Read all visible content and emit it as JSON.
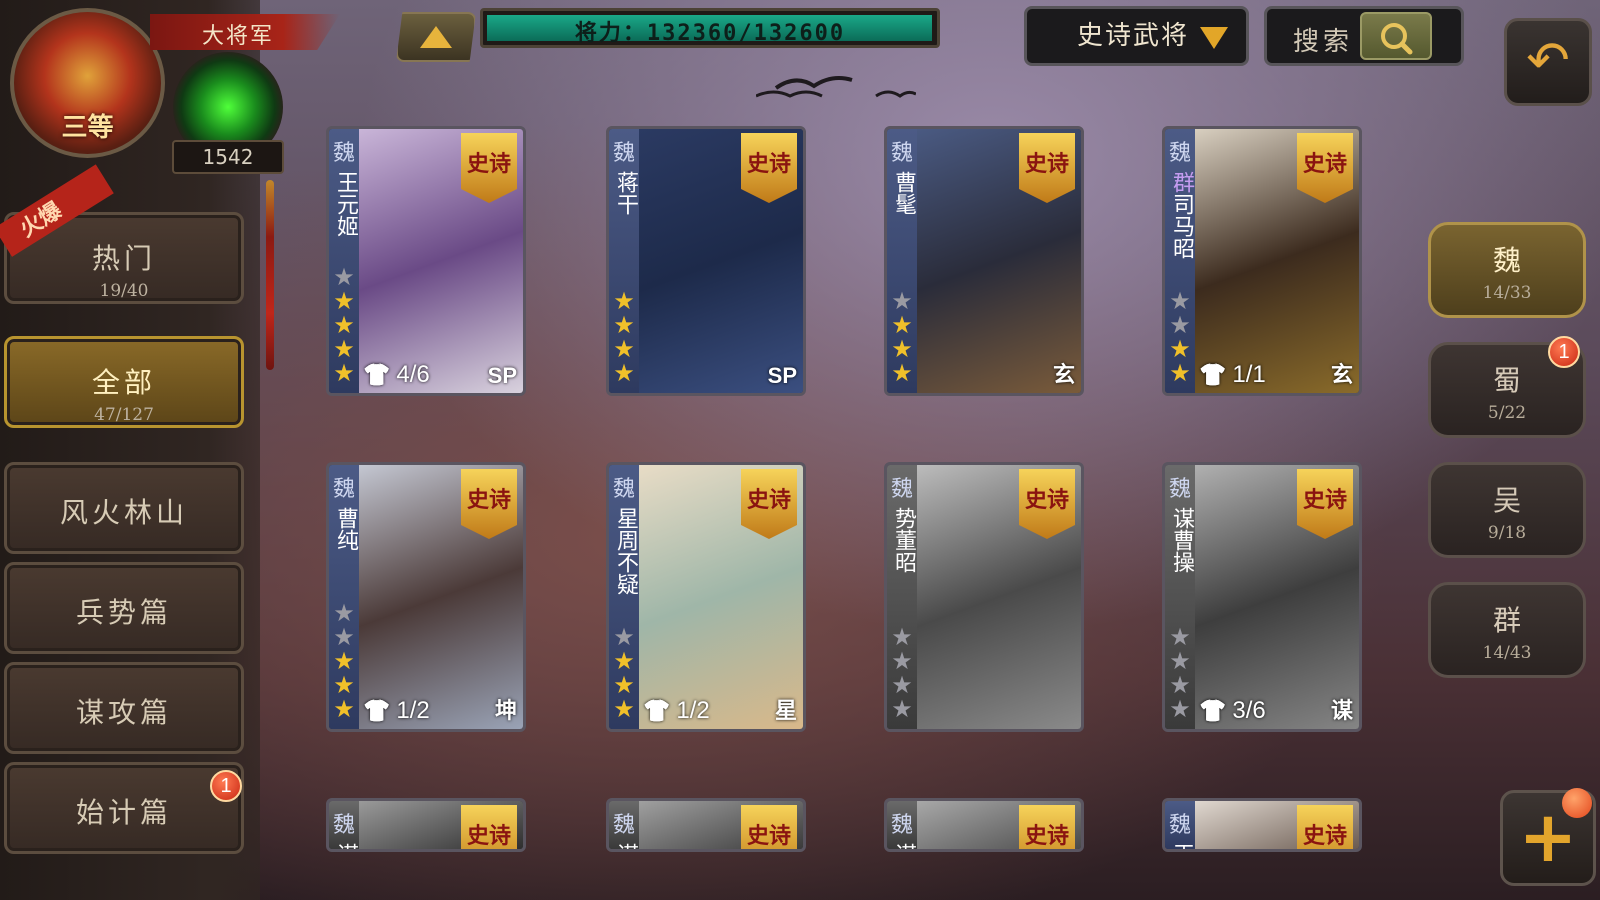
{
  "header": {
    "rank_text": "三等",
    "title": "大将军",
    "gem_count": "1542",
    "power_text": "将力：132360/132600",
    "power_current": 132360,
    "power_max": 132600,
    "filter_label": "史诗武将",
    "search_label": "搜索"
  },
  "categories": [
    {
      "label": "热门",
      "count": "19/40",
      "ribbon": "火爆"
    },
    {
      "label": "全部",
      "count": "47/127",
      "active": true
    },
    {
      "label": "风火林山"
    },
    {
      "label": "兵势篇"
    },
    {
      "label": "谋攻篇"
    },
    {
      "label": "始计篇",
      "badge": "1"
    }
  ],
  "factions": [
    {
      "label": "魏",
      "count": "14/33",
      "active": true
    },
    {
      "label": "蜀",
      "count": "5/22",
      "badge": "1"
    },
    {
      "label": "吴",
      "count": "9/18"
    },
    {
      "label": "群",
      "count": "14/43"
    }
  ],
  "cards": [
    {
      "faction": "魏",
      "name": "王元姬",
      "stars_filled": 4,
      "stars_empty": 1,
      "epic": "史诗",
      "skin": "4/6",
      "tag": "SP"
    },
    {
      "faction": "魏",
      "name": "蒋干",
      "stars_filled": 4,
      "stars_empty": 0,
      "epic": "史诗",
      "skin": "",
      "tag": "SP"
    },
    {
      "faction": "魏",
      "name": "曹髦",
      "stars_filled": 3,
      "stars_empty": 1,
      "epic": "史诗",
      "skin": "",
      "tag": "玄"
    },
    {
      "faction": "魏",
      "faction2": "群",
      "name": "司马昭",
      "stars_filled": 2,
      "stars_empty": 2,
      "epic": "史诗",
      "skin": "1/1",
      "tag": "玄"
    },
    {
      "faction": "魏",
      "name": "曹纯",
      "stars_filled": 3,
      "stars_empty": 2,
      "epic": "史诗",
      "skin": "1/2",
      "tag": "坤"
    },
    {
      "faction": "魏",
      "name": "星周不疑",
      "stars_filled": 3,
      "stars_empty": 1,
      "epic": "史诗",
      "skin": "1/2",
      "tag": "星"
    },
    {
      "faction": "魏",
      "name": "势董昭",
      "stars_filled": 0,
      "stars_empty": 4,
      "epic": "史诗",
      "skin": "",
      "tag": "",
      "gray": true
    },
    {
      "faction": "魏",
      "name": "谋曹操",
      "stars_filled": 0,
      "stars_empty": 4,
      "epic": "史诗",
      "skin": "3/6",
      "tag": "谋",
      "gray": true
    },
    {
      "faction": "魏",
      "name": "谋",
      "epic": "史诗",
      "gray": true,
      "partial": true
    },
    {
      "faction": "魏",
      "name": "谋",
      "epic": "史诗",
      "gray": true,
      "partial": true
    },
    {
      "faction": "魏",
      "name": "谋",
      "epic": "史诗",
      "gray": true,
      "partial": true
    },
    {
      "faction": "魏",
      "name": "王",
      "epic": "史诗",
      "partial": true
    }
  ],
  "colors": {
    "accent_gold": "#e3a52c",
    "power_fill": "#1aa888",
    "badge_red": "#c82612"
  },
  "icons": {
    "back": "back-arrow-icon",
    "search": "magnifier-icon",
    "add": "plus-icon"
  }
}
